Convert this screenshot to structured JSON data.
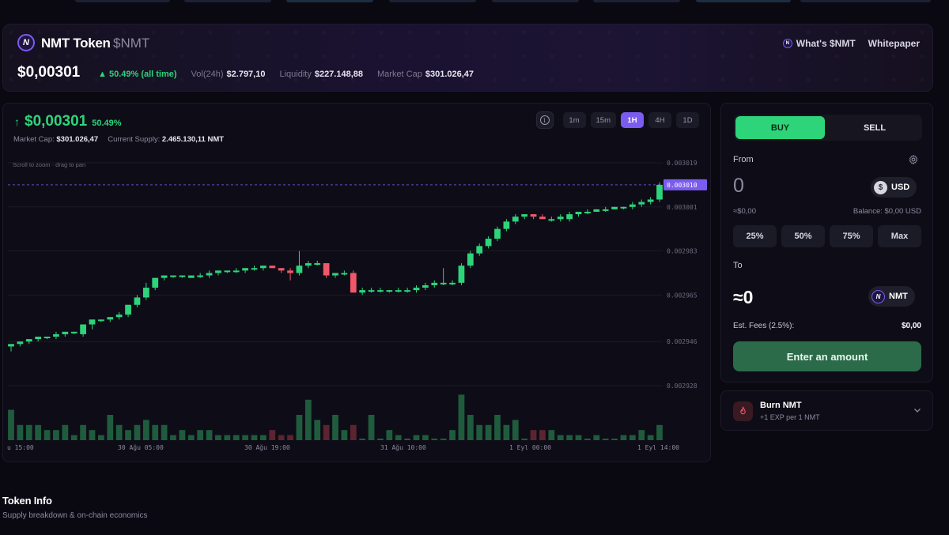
{
  "header": {
    "token_name": "NMT Token",
    "ticker": "$NMT",
    "logo_letter": "N",
    "price": "$0,00301",
    "change": "50.49% (all time)",
    "vol_label": "Vol(24h)",
    "vol_value": "$2.797,10",
    "liq_label": "Liquidity",
    "liq_value": "$227.148,88",
    "mcap_label": "Market Cap",
    "mcap_value": "$301.026,47",
    "link_whats": "What's $NMT",
    "link_whitepaper": "Whitepaper"
  },
  "chart_header": {
    "price": "$0,00301",
    "change": "50.49%",
    "mcap_label": "Market Cap:",
    "mcap_value": "$301.026,47",
    "supply_label": "Current Supply:",
    "supply_value": "2.465.130,11 NMT",
    "hint": "Scroll to zoom · drag to pan",
    "timeframes": [
      "1m",
      "15m",
      "1H",
      "4H",
      "1D"
    ],
    "active_timeframe": "1H",
    "info_glyph": "i"
  },
  "chart_data": {
    "type": "candlestick",
    "y_ticks": [
      "0.003019",
      "0.003001",
      "0.002983",
      "0.002965",
      "0.002946",
      "0.002928"
    ],
    "y_tick_values": [
      0.003019,
      0.003001,
      0.002983,
      0.002965,
      0.002946,
      0.002928
    ],
    "current_price_label": "0.003010",
    "current_price": 0.00301,
    "x_ticks": [
      "u 15:00",
      "30 Ağu 05:00",
      "30 Ağu 19:00",
      "31 Ağu 10:00",
      "1 Eyl 00:00",
      "1 Eyl 14:00"
    ],
    "candles": [
      {
        "o": 0.002944,
        "h": 0.002945,
        "l": 0.002942,
        "c": 0.002945
      },
      {
        "o": 0.002945,
        "h": 0.002946,
        "l": 0.002944,
        "c": 0.002946
      },
      {
        "o": 0.002946,
        "h": 0.002947,
        "l": 0.002945,
        "c": 0.002947
      },
      {
        "o": 0.002947,
        "h": 0.002948,
        "l": 0.002946,
        "c": 0.002948
      },
      {
        "o": 0.002948,
        "h": 0.002948,
        "l": 0.002947,
        "c": 0.002948
      },
      {
        "o": 0.002948,
        "h": 0.00295,
        "l": 0.002947,
        "c": 0.002949
      },
      {
        "o": 0.002949,
        "h": 0.00295,
        "l": 0.002948,
        "c": 0.00295
      },
      {
        "o": 0.00295,
        "h": 0.00295,
        "l": 0.002949,
        "c": 0.00295
      },
      {
        "o": 0.002949,
        "h": 0.002953,
        "l": 0.002948,
        "c": 0.002953
      },
      {
        "o": 0.002953,
        "h": 0.002955,
        "l": 0.002951,
        "c": 0.002955
      },
      {
        "o": 0.002955,
        "h": 0.002955,
        "l": 0.002954,
        "c": 0.002955
      },
      {
        "o": 0.002955,
        "h": 0.002956,
        "l": 0.002954,
        "c": 0.002956
      },
      {
        "o": 0.002956,
        "h": 0.002958,
        "l": 0.002955,
        "c": 0.002957
      },
      {
        "o": 0.002957,
        "h": 0.002961,
        "l": 0.002956,
        "c": 0.002961
      },
      {
        "o": 0.002961,
        "h": 0.002965,
        "l": 0.00296,
        "c": 0.002964
      },
      {
        "o": 0.002964,
        "h": 0.00297,
        "l": 0.002963,
        "c": 0.002968
      },
      {
        "o": 0.002968,
        "h": 0.002972,
        "l": 0.002967,
        "c": 0.002972
      },
      {
        "o": 0.002972,
        "h": 0.002973,
        "l": 0.002971,
        "c": 0.002973
      },
      {
        "o": 0.002973,
        "h": 0.002973,
        "l": 0.002972,
        "c": 0.002973
      },
      {
        "o": 0.002973,
        "h": 0.002973,
        "l": 0.002972,
        "c": 0.002973
      },
      {
        "o": 0.002972,
        "h": 0.002973,
        "l": 0.002972,
        "c": 0.002973
      },
      {
        "o": 0.002973,
        "h": 0.002974,
        "l": 0.002972,
        "c": 0.002973
      },
      {
        "o": 0.002973,
        "h": 0.002975,
        "l": 0.002972,
        "c": 0.002974
      },
      {
        "o": 0.002974,
        "h": 0.002975,
        "l": 0.002973,
        "c": 0.002975
      },
      {
        "o": 0.002975,
        "h": 0.002975,
        "l": 0.002974,
        "c": 0.002975
      },
      {
        "o": 0.002975,
        "h": 0.002976,
        "l": 0.002974,
        "c": 0.002975
      },
      {
        "o": 0.002975,
        "h": 0.002976,
        "l": 0.002974,
        "c": 0.002976
      },
      {
        "o": 0.002976,
        "h": 0.002977,
        "l": 0.002975,
        "c": 0.002976
      },
      {
        "o": 0.002976,
        "h": 0.002977,
        "l": 0.002975,
        "c": 0.002977
      },
      {
        "o": 0.002977,
        "h": 0.002977,
        "l": 0.002976,
        "c": 0.002976
      },
      {
        "o": 0.002976,
        "h": 0.002976,
        "l": 0.002974,
        "c": 0.002975
      },
      {
        "o": 0.002975,
        "h": 0.002976,
        "l": 0.002971,
        "c": 0.002974
      },
      {
        "o": 0.002974,
        "h": 0.002983,
        "l": 0.002973,
        "c": 0.002977
      },
      {
        "o": 0.002977,
        "h": 0.002979,
        "l": 0.002976,
        "c": 0.002978
      },
      {
        "o": 0.002978,
        "h": 0.002979,
        "l": 0.002977,
        "c": 0.002978
      },
      {
        "o": 0.002978,
        "h": 0.002978,
        "l": 0.002972,
        "c": 0.002973
      },
      {
        "o": 0.002973,
        "h": 0.002974,
        "l": 0.002972,
        "c": 0.002974
      },
      {
        "o": 0.002974,
        "h": 0.002975,
        "l": 0.002973,
        "c": 0.002974
      },
      {
        "o": 0.002974,
        "h": 0.002975,
        "l": 0.002966,
        "c": 0.002966
      },
      {
        "o": 0.002966,
        "h": 0.002968,
        "l": 0.002965,
        "c": 0.002967
      },
      {
        "o": 0.002967,
        "h": 0.002968,
        "l": 0.002966,
        "c": 0.002967
      },
      {
        "o": 0.002967,
        "h": 0.002968,
        "l": 0.002966,
        "c": 0.002967
      },
      {
        "o": 0.002967,
        "h": 0.002967,
        "l": 0.002966,
        "c": 0.002967
      },
      {
        "o": 0.002967,
        "h": 0.002968,
        "l": 0.002966,
        "c": 0.002967
      },
      {
        "o": 0.002967,
        "h": 0.002968,
        "l": 0.002966,
        "c": 0.002967
      },
      {
        "o": 0.002967,
        "h": 0.002969,
        "l": 0.002966,
        "c": 0.002968
      },
      {
        "o": 0.002968,
        "h": 0.00297,
        "l": 0.002967,
        "c": 0.002969
      },
      {
        "o": 0.002969,
        "h": 0.002971,
        "l": 0.002968,
        "c": 0.00297
      },
      {
        "o": 0.00297,
        "h": 0.002976,
        "l": 0.002969,
        "c": 0.00297
      },
      {
        "o": 0.00297,
        "h": 0.002971,
        "l": 0.002969,
        "c": 0.00297
      },
      {
        "o": 0.00297,
        "h": 0.002978,
        "l": 0.002969,
        "c": 0.002977
      },
      {
        "o": 0.002977,
        "h": 0.002983,
        "l": 0.002976,
        "c": 0.002982
      },
      {
        "o": 0.002982,
        "h": 0.002986,
        "l": 0.002981,
        "c": 0.002985
      },
      {
        "o": 0.002985,
        "h": 0.002989,
        "l": 0.002984,
        "c": 0.002988
      },
      {
        "o": 0.002988,
        "h": 0.002993,
        "l": 0.002987,
        "c": 0.002992
      },
      {
        "o": 0.002992,
        "h": 0.002996,
        "l": 0.002991,
        "c": 0.002995
      },
      {
        "o": 0.002995,
        "h": 0.002998,
        "l": 0.002994,
        "c": 0.002997
      },
      {
        "o": 0.002997,
        "h": 0.002998,
        "l": 0.002996,
        "c": 0.002998
      },
      {
        "o": 0.002998,
        "h": 0.002998,
        "l": 0.002996,
        "c": 0.002997
      },
      {
        "o": 0.002997,
        "h": 0.002998,
        "l": 0.002996,
        "c": 0.002996
      },
      {
        "o": 0.002996,
        "h": 0.002997,
        "l": 0.002995,
        "c": 0.002996
      },
      {
        "o": 0.002996,
        "h": 0.002998,
        "l": 0.002995,
        "c": 0.002997
      },
      {
        "o": 0.002996,
        "h": 0.002999,
        "l": 0.002995,
        "c": 0.002998
      },
      {
        "o": 0.002998,
        "h": 0.002999,
        "l": 0.002997,
        "c": 0.002999
      },
      {
        "o": 0.002999,
        "h": 0.003,
        "l": 0.002998,
        "c": 0.002999
      },
      {
        "o": 0.002999,
        "h": 0.003,
        "l": 0.002999,
        "c": 0.003
      },
      {
        "o": 0.003,
        "h": 0.003001,
        "l": 0.002999,
        "c": 0.003
      },
      {
        "o": 0.003,
        "h": 0.003001,
        "l": 0.003,
        "c": 0.003001
      },
      {
        "o": 0.003001,
        "h": 0.003001,
        "l": 0.003,
        "c": 0.003001
      },
      {
        "o": 0.003001,
        "h": 0.003003,
        "l": 0.003,
        "c": 0.003002
      },
      {
        "o": 0.003002,
        "h": 0.003004,
        "l": 0.003001,
        "c": 0.003003
      },
      {
        "o": 0.003003,
        "h": 0.003005,
        "l": 0.003002,
        "c": 0.003004
      },
      {
        "o": 0.003004,
        "h": 0.003011,
        "l": 0.003003,
        "c": 0.00301
      }
    ],
    "volumes": [
      6,
      3,
      3,
      3,
      2,
      2,
      3,
      1,
      3,
      2,
      1,
      5,
      3,
      2,
      3,
      4,
      3,
      3,
      1,
      2,
      1,
      2,
      2,
      1,
      1,
      1,
      1,
      1,
      1,
      2,
      1,
      1,
      5,
      8,
      4,
      3,
      5,
      2,
      3,
      0,
      5,
      0,
      2,
      1,
      0,
      1,
      1,
      0,
      0,
      2,
      9,
      5,
      3,
      3,
      5,
      3,
      4,
      0,
      2,
      2,
      2,
      1,
      1,
      1,
      0,
      1,
      0,
      0,
      1,
      1,
      2,
      1,
      3
    ],
    "volume_max": 10,
    "colors": {
      "up": "#2ed47a",
      "down": "#f0586a",
      "vol_up": "#1f5c3d",
      "vol_down": "#5c2430"
    }
  },
  "trade": {
    "tab_buy": "BUY",
    "tab_sell": "SELL",
    "from_label": "From",
    "amount_value": "0",
    "from_token": "USD",
    "from_coin_glyph": "$",
    "approx_usd": "≈$0,00",
    "balance": "Balance: $0,00 USD",
    "pct_buttons": [
      "25%",
      "50%",
      "75%",
      "Max"
    ],
    "to_label": "To",
    "to_amount": "≈0",
    "to_token": "NMT",
    "fees_label": "Est. Fees (2.5%):",
    "fees_value": "$0,00",
    "submit_label": "Enter an amount"
  },
  "burn": {
    "title": "Burn NMT",
    "subtitle": "+1 EXP per 1 NMT"
  },
  "token_info": {
    "title": "Token Info",
    "subtitle": "Supply breakdown & on-chain economics"
  },
  "theme": {
    "accent": "#7b5cf0",
    "positive": "#2ed47a",
    "negative": "#f0586a"
  }
}
